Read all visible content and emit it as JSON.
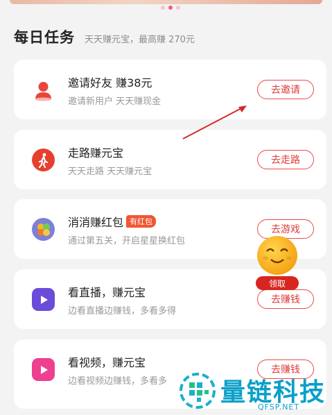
{
  "carousel": {
    "count": 3,
    "active_index": 1
  },
  "header": {
    "title": "每日任务",
    "subtitle": "天天赚元宝，最高赚 270元"
  },
  "tasks": [
    {
      "name": "邀请好友 赚38元",
      "tag": "",
      "desc": "邀请新用户 天天赚现金",
      "button": "去邀请",
      "icon": "person-icon",
      "icon_color": "#e9453a"
    },
    {
      "name": "走路赚元宝",
      "tag": "",
      "desc": "天天走路 天天赚元宝",
      "button": "去走路",
      "icon": "walking-icon",
      "icon_color": "#e5402f"
    },
    {
      "name": "消消赚红包",
      "tag": "有红包",
      "desc": "通过第五关，开启星星换红包",
      "button": "去游戏",
      "icon": "match-game-icon",
      "icon_color": "#6b6fd6"
    },
    {
      "name": "看直播，赚元宝",
      "tag": "",
      "desc": "边看直播边赚钱，多看多得",
      "button": "去赚钱",
      "icon": "play-icon",
      "icon_color": "#6a4cd8"
    },
    {
      "name": "看视频，赚元宝",
      "tag": "",
      "desc": "边看视频边赚钱，多看多",
      "button": "去赚钱",
      "icon": "play-icon",
      "icon_color": "#ef3f8f"
    }
  ],
  "floating_mascot": {
    "claim_label": "领取"
  },
  "watermark": {
    "text": "量链科技",
    "domain": "QFSP.NET"
  },
  "colors": {
    "accent": "#e03a3a",
    "background": "#f3f3f3"
  }
}
